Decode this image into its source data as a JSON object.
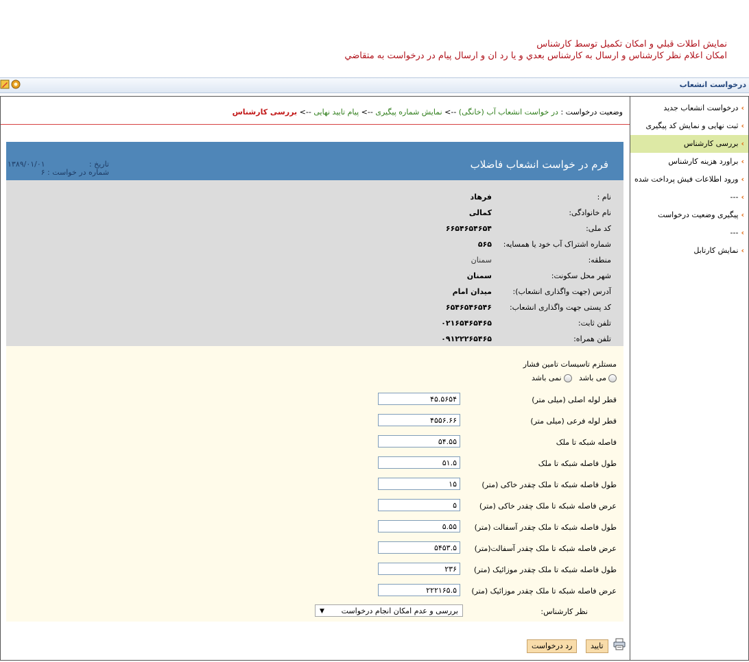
{
  "top_notes": {
    "line1": "نمايش اطلات  قبلي و امكان تكميل توسط كارشناس",
    "line2": "امكان اعلام نظر كارشناس و ارسال به كارشناس بعدي  و يا رد ان و ارسال پيام در درخواست به متقاضي"
  },
  "title_bar": {
    "title": "درخواست انشعاب"
  },
  "toolbar": {
    "icons": [
      "settings-icon",
      "edit-icon"
    ]
  },
  "sidebar": {
    "items": [
      {
        "label": "درخواست انشعاب جدید"
      },
      {
        "label": "ثبت نهایی و نمایش کد پیگیری"
      },
      {
        "label": "بررسی کارشناس"
      },
      {
        "label": "براورد هزینه کارشناس"
      },
      {
        "label": "ورود اطلاعات فیش پرداخت شده"
      },
      {
        "label": "---"
      },
      {
        "label": "پیگیری وضعیت درخواست"
      },
      {
        "label": "---"
      },
      {
        "label": "نمایش کارتابل"
      }
    ],
    "active_index": 2
  },
  "status": {
    "prefix": "وضعیت درخواست :",
    "step1": "در خواست انشعاب آب (خانگی)",
    "sep": " --> ",
    "step2": "نمایش شماره پیگیری",
    "step3": "پیام تایید نهایی",
    "current": "بررسی کارشناس"
  },
  "form_header": {
    "title": "فرم در خواست انشعاب فاضلاب",
    "date_label": "تاریخ :",
    "date_value": "۱۳۸۹/۰۱/۰۱",
    "request_no": "شماره در خواست : ۶"
  },
  "info": {
    "rows": [
      {
        "label": "نام :",
        "value": "فرهاد"
      },
      {
        "label": "نام خانوادگی:",
        "value": "کمالی"
      },
      {
        "label": "کد ملی:",
        "value": "۶۶۵۴۶۵۴۶۵۴"
      },
      {
        "label": "شماره اشتراک آب خود یا همسایه:",
        "value": "۵۶۵"
      },
      {
        "label": "منطقه:",
        "value": "سمنان"
      },
      {
        "label": "شهر محل سکونت:",
        "value": "سمنان"
      },
      {
        "label": "آدرس (جهت واگذاری انشعاب):",
        "value": "میدان امام"
      },
      {
        "label": "کد پستی جهت واگذاری انشعاب:",
        "value": "۶۵۴۶۵۴۶۵۴۶"
      },
      {
        "label": "تلفن ثابت:",
        "value": "۰۲۱۶۵۴۶۵۴۶۵"
      },
      {
        "label": "تلفن همراه:",
        "value": "۰۹۱۲۲۲۶۵۴۶۵"
      }
    ]
  },
  "technical": {
    "pressure_label": "مستلزم تاسیسات تامین فشار",
    "option_yes": "می باشد",
    "option_no": "نمی باشد",
    "fields": [
      {
        "label": "قطر لوله اصلی (میلی متر)",
        "value": "۴۵.۵۶۵۴"
      },
      {
        "label": "قطر لوله فرعی (میلی متر)",
        "value": "۴۵۵۶.۶۶"
      },
      {
        "label": "فاصله شبکه تا ملک",
        "value": "۵۴.۵۵"
      },
      {
        "label": "طول فاصله شبکه تا ملک",
        "value": "۵۱.۵"
      },
      {
        "label": "طول فاصله شبکه تا ملک چقدر خاکی (متر)",
        "value": "۱۵"
      },
      {
        "label": "عرض فاصله شبکه تا ملک چقدر خاکی (متر)",
        "value": "۵"
      },
      {
        "label": "طول فاصله شبکه تا ملک چقدر آسفالت  (متر)",
        "value": "۵.۵۵"
      },
      {
        "label": "عرض فاصله شبکه تا ملک چقدر آسفالت(متر)",
        "value": "۵۴۵۳.۵"
      },
      {
        "label": "طول فاصله شبکه تا ملک چقدر موزائیک  (متر)",
        "value": "۲۳۶"
      },
      {
        "label": "عرض فاصله شبکه تا ملک چقدر موزائیک (متر)",
        "value": "۲۲۲۱۶۵.۵"
      }
    ],
    "expert_label": "نظر کارشناس:",
    "expert_selected": "بررسی و عدم امکان انجام درخواست"
  },
  "actions": {
    "confirm": "تایید",
    "reject": "رد درخواست"
  },
  "colors": {
    "header_blue": "#4f86b8",
    "info_gray": "#dcdcdc",
    "tech_cream": "#fffbea",
    "active_sidebar": "#dde9a5",
    "note_red": "#b0121b",
    "button_orange": "#f8dcaa"
  }
}
